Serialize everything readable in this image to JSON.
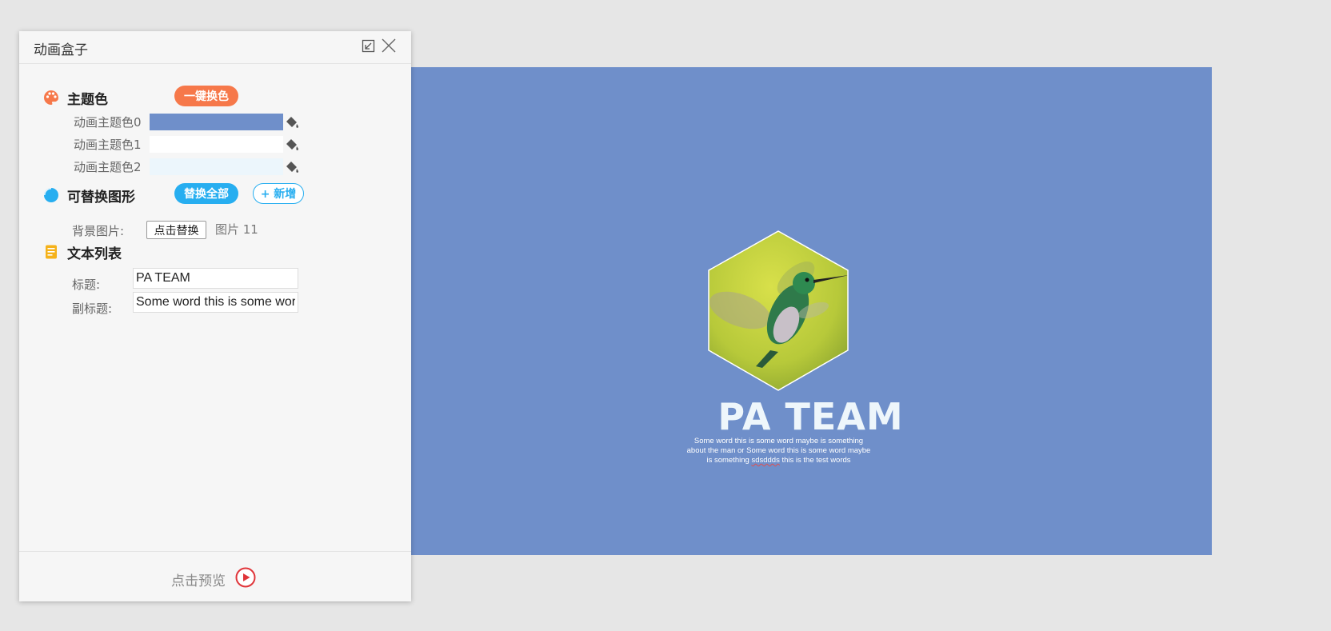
{
  "panel": {
    "title": "动画盒子",
    "theme_section": {
      "title": "主题色",
      "one_click_button": "一键换色",
      "colors": [
        {
          "label": "动画主题色0",
          "color": "#6f8fca"
        },
        {
          "label": "动画主题色1",
          "color": "#ffffff"
        },
        {
          "label": "动画主题色2",
          "color": "#ecf6fc"
        }
      ]
    },
    "shape_section": {
      "title": "可替换图形",
      "replace_all_button": "替换全部",
      "add_button": "+ 新增",
      "bg_label": "背景图片:",
      "replace_button": "点击替换",
      "image_name": "图片 11"
    },
    "text_section": {
      "title": "文本列表",
      "title_label": "标题:",
      "title_value": "PA TEAM",
      "subtitle_label": "副标题:",
      "subtitle_value": "Some word this is some word maybe is something about the man or  Some word this is some word maybe is something sdsddds this is the test words"
    },
    "footer": {
      "preview_label": "点击预览"
    },
    "icons": [
      "restore-icon",
      "close-icon",
      "palette-icon",
      "pie-icon",
      "document-icon",
      "paint-bucket-icon",
      "play-icon"
    ]
  },
  "slide": {
    "background": "#6f8fca",
    "title": "PA TEAM",
    "subtitle_line1": "Some word this is some word maybe is something",
    "subtitle_line2": "about the man or  Some word this is some word maybe",
    "subtitle_line3_a": "is something ",
    "subtitle_line3_b": "sdsddds",
    "subtitle_line3_c": " this is the test words"
  }
}
